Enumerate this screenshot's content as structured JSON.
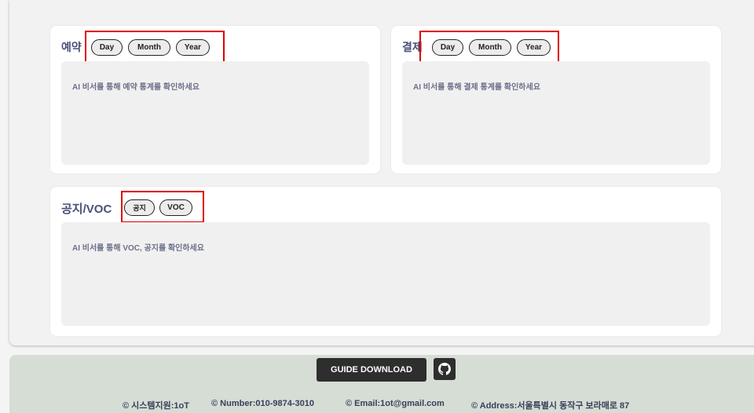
{
  "reservation": {
    "title": "예약",
    "buttons": [
      "Day",
      "Month",
      "Year"
    ],
    "hint": "AI 비서를 통해 예약 통계를 확인하세요"
  },
  "payment": {
    "title": "결제",
    "buttons": [
      "Day",
      "Month",
      "Year"
    ],
    "hint": "AI 비서를 통해 결제 통계를 확인하세요"
  },
  "notice": {
    "title": "공지/VOC",
    "buttons": [
      "공지",
      "VOC"
    ],
    "hint": "AI 비서를 통해 VOC, 공지를 확인하세요"
  },
  "footer": {
    "guide_label": "GUIDE DOWNLOAD",
    "github_icon": "github-icon",
    "info": [
      "© 시스템지원:1oT",
      "© Number:010-9874-3010",
      "© Email:1ot@gmail.com",
      "© Address:서울특별시 동작구 보라매로 87"
    ]
  },
  "colors": {
    "highlight": "#e00000",
    "title": "#4a4f7a",
    "footer_bg": "#d5ddd5",
    "button_dark": "#2e2e2e"
  }
}
